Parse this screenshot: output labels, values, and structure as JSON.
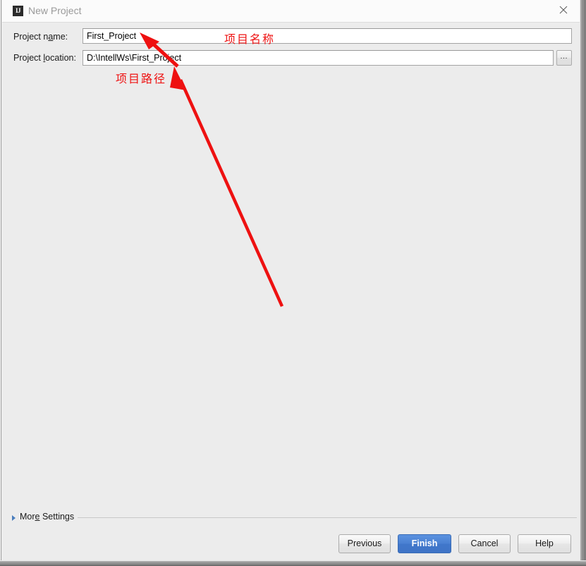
{
  "window": {
    "title": "New Project",
    "app_icon_label": "IJ",
    "close_icon_label": "×"
  },
  "form": {
    "name_row": {
      "label_pre": "Project n",
      "label_mnemonic": "a",
      "label_post": "me:",
      "value": "First_Project",
      "placeholder": "Project name"
    },
    "location_row": {
      "label_pre": "Project ",
      "label_mnemonic": "l",
      "label_post": "ocation:",
      "value": "D:\\IntellWs\\First_Project",
      "placeholder": "Project location",
      "browse_label": "…"
    }
  },
  "more_settings": {
    "label_pre": "Mor",
    "label_mnemonic": "e",
    "label_post": " Settings",
    "expanded": "false"
  },
  "buttons": {
    "previous": "Previous",
    "finish": "Finish",
    "cancel": "Cancel",
    "help": "Help"
  },
  "annotations": {
    "project_name_note": "项目名称",
    "project_path_note": "项目路径",
    "color": "#ee1111"
  },
  "colors": {
    "dialog_background": "#ececec",
    "titlebar_background": "#fbfbfb",
    "field_background": "#ffffff",
    "field_border": "#a4a4a4",
    "primary_button": "#4a80d2",
    "annotation_red": "#ee1111",
    "disclosure_arrow": "#4a7dbd"
  }
}
